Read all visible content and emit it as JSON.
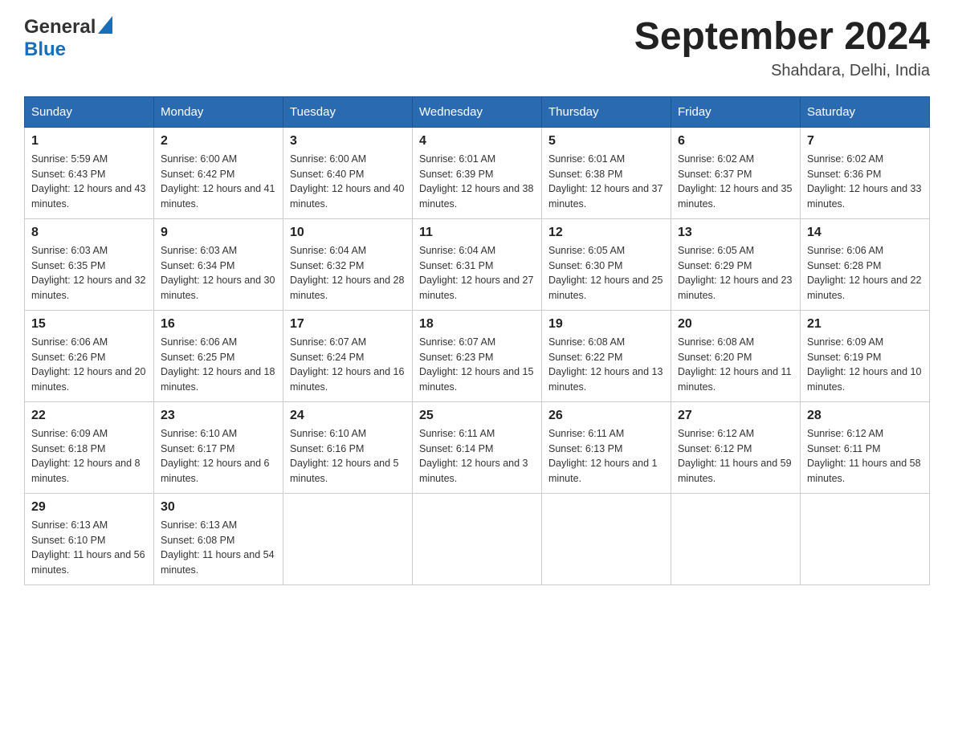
{
  "header": {
    "logo_general": "General",
    "logo_blue": "Blue",
    "month_title": "September 2024",
    "location": "Shahdara, Delhi, India"
  },
  "days_of_week": [
    "Sunday",
    "Monday",
    "Tuesday",
    "Wednesday",
    "Thursday",
    "Friday",
    "Saturday"
  ],
  "weeks": [
    [
      {
        "day": "1",
        "sunrise": "5:59 AM",
        "sunset": "6:43 PM",
        "daylight": "12 hours and 43 minutes."
      },
      {
        "day": "2",
        "sunrise": "6:00 AM",
        "sunset": "6:42 PM",
        "daylight": "12 hours and 41 minutes."
      },
      {
        "day": "3",
        "sunrise": "6:00 AM",
        "sunset": "6:40 PM",
        "daylight": "12 hours and 40 minutes."
      },
      {
        "day": "4",
        "sunrise": "6:01 AM",
        "sunset": "6:39 PM",
        "daylight": "12 hours and 38 minutes."
      },
      {
        "day": "5",
        "sunrise": "6:01 AM",
        "sunset": "6:38 PM",
        "daylight": "12 hours and 37 minutes."
      },
      {
        "day": "6",
        "sunrise": "6:02 AM",
        "sunset": "6:37 PM",
        "daylight": "12 hours and 35 minutes."
      },
      {
        "day": "7",
        "sunrise": "6:02 AM",
        "sunset": "6:36 PM",
        "daylight": "12 hours and 33 minutes."
      }
    ],
    [
      {
        "day": "8",
        "sunrise": "6:03 AM",
        "sunset": "6:35 PM",
        "daylight": "12 hours and 32 minutes."
      },
      {
        "day": "9",
        "sunrise": "6:03 AM",
        "sunset": "6:34 PM",
        "daylight": "12 hours and 30 minutes."
      },
      {
        "day": "10",
        "sunrise": "6:04 AM",
        "sunset": "6:32 PM",
        "daylight": "12 hours and 28 minutes."
      },
      {
        "day": "11",
        "sunrise": "6:04 AM",
        "sunset": "6:31 PM",
        "daylight": "12 hours and 27 minutes."
      },
      {
        "day": "12",
        "sunrise": "6:05 AM",
        "sunset": "6:30 PM",
        "daylight": "12 hours and 25 minutes."
      },
      {
        "day": "13",
        "sunrise": "6:05 AM",
        "sunset": "6:29 PM",
        "daylight": "12 hours and 23 minutes."
      },
      {
        "day": "14",
        "sunrise": "6:06 AM",
        "sunset": "6:28 PM",
        "daylight": "12 hours and 22 minutes."
      }
    ],
    [
      {
        "day": "15",
        "sunrise": "6:06 AM",
        "sunset": "6:26 PM",
        "daylight": "12 hours and 20 minutes."
      },
      {
        "day": "16",
        "sunrise": "6:06 AM",
        "sunset": "6:25 PM",
        "daylight": "12 hours and 18 minutes."
      },
      {
        "day": "17",
        "sunrise": "6:07 AM",
        "sunset": "6:24 PM",
        "daylight": "12 hours and 16 minutes."
      },
      {
        "day": "18",
        "sunrise": "6:07 AM",
        "sunset": "6:23 PM",
        "daylight": "12 hours and 15 minutes."
      },
      {
        "day": "19",
        "sunrise": "6:08 AM",
        "sunset": "6:22 PM",
        "daylight": "12 hours and 13 minutes."
      },
      {
        "day": "20",
        "sunrise": "6:08 AM",
        "sunset": "6:20 PM",
        "daylight": "12 hours and 11 minutes."
      },
      {
        "day": "21",
        "sunrise": "6:09 AM",
        "sunset": "6:19 PM",
        "daylight": "12 hours and 10 minutes."
      }
    ],
    [
      {
        "day": "22",
        "sunrise": "6:09 AM",
        "sunset": "6:18 PM",
        "daylight": "12 hours and 8 minutes."
      },
      {
        "day": "23",
        "sunrise": "6:10 AM",
        "sunset": "6:17 PM",
        "daylight": "12 hours and 6 minutes."
      },
      {
        "day": "24",
        "sunrise": "6:10 AM",
        "sunset": "6:16 PM",
        "daylight": "12 hours and 5 minutes."
      },
      {
        "day": "25",
        "sunrise": "6:11 AM",
        "sunset": "6:14 PM",
        "daylight": "12 hours and 3 minutes."
      },
      {
        "day": "26",
        "sunrise": "6:11 AM",
        "sunset": "6:13 PM",
        "daylight": "12 hours and 1 minute."
      },
      {
        "day": "27",
        "sunrise": "6:12 AM",
        "sunset": "6:12 PM",
        "daylight": "11 hours and 59 minutes."
      },
      {
        "day": "28",
        "sunrise": "6:12 AM",
        "sunset": "6:11 PM",
        "daylight": "11 hours and 58 minutes."
      }
    ],
    [
      {
        "day": "29",
        "sunrise": "6:13 AM",
        "sunset": "6:10 PM",
        "daylight": "11 hours and 56 minutes."
      },
      {
        "day": "30",
        "sunrise": "6:13 AM",
        "sunset": "6:08 PM",
        "daylight": "11 hours and 54 minutes."
      },
      null,
      null,
      null,
      null,
      null
    ]
  ],
  "labels": {
    "sunrise": "Sunrise:",
    "sunset": "Sunset:",
    "daylight": "Daylight:"
  }
}
